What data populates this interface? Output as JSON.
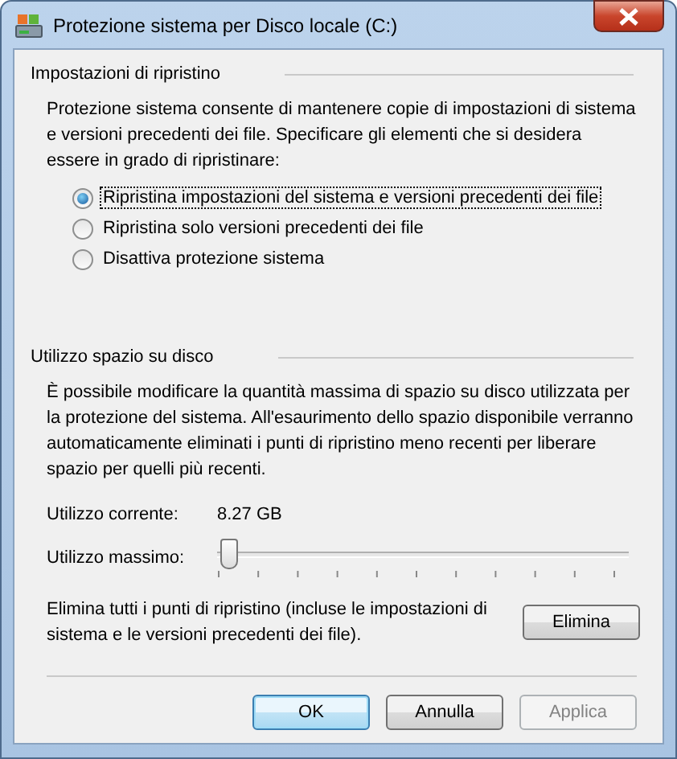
{
  "window": {
    "title": "Protezione sistema per Disco locale (C:)"
  },
  "restore_settings": {
    "heading": "Impostazioni di ripristino",
    "description": "Protezione sistema consente di mantenere copie di impostazioni di sistema e versioni precedenti dei file. Specificare gli elementi che si desidera essere in grado di ripristinare:",
    "options": [
      {
        "label": "Ripristina impostazioni del sistema e versioni precedenti dei file",
        "selected": true
      },
      {
        "label": "Ripristina solo versioni precedenti dei file",
        "selected": false
      },
      {
        "label": "Disattiva protezione sistema",
        "selected": false
      }
    ]
  },
  "disk_usage": {
    "heading": "Utilizzo spazio su disco",
    "description": "È possibile modificare la quantità massima di spazio su disco utilizzata per la protezione del sistema. All'esaurimento dello spazio disponibile verranno automaticamente eliminati i punti di ripristino meno recenti per liberare spazio per quelli più recenti.",
    "current_usage": {
      "label": "Utilizzo corrente:",
      "value": "8.27 GB"
    },
    "max_usage": {
      "label": "Utilizzo massimo:",
      "level": 0.01
    },
    "delete": {
      "description": "Elimina tutti i punti di ripristino (incluse le impostazioni di sistema e le versioni precedenti dei file).",
      "button": "Elimina"
    }
  },
  "buttons": [
    {
      "label": "OK",
      "kind": "default",
      "disabled": false
    },
    {
      "label": "Annulla",
      "kind": "normal",
      "disabled": false
    },
    {
      "label": "Applica",
      "kind": "normal",
      "disabled": true
    }
  ]
}
